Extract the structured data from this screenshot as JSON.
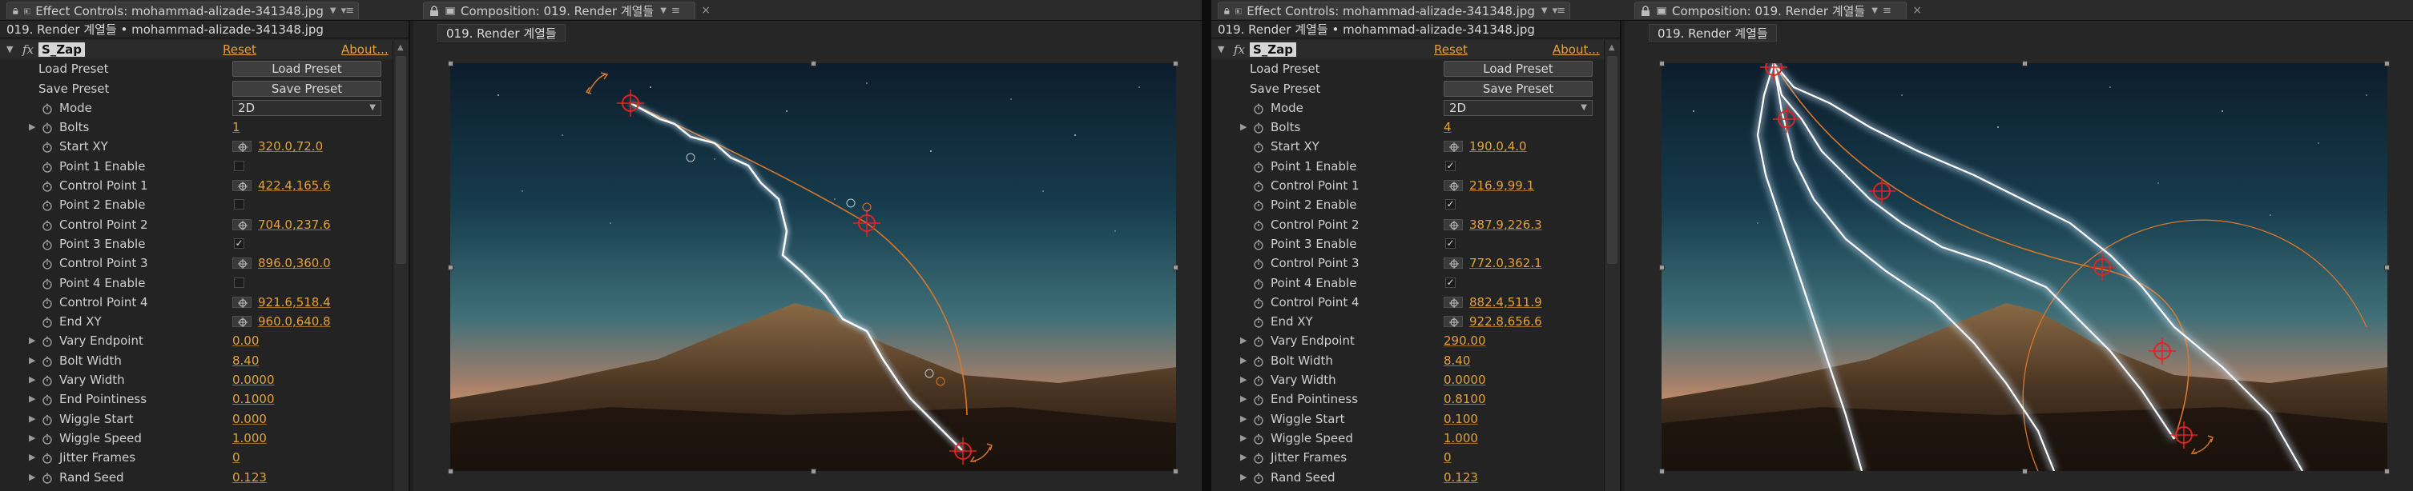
{
  "panels": [
    {
      "effect_controls": {
        "tab_title": "Effect Controls: mohammad-alizade-341348.jpg",
        "subtitle": "019. Render 계열들 • mohammad-alizade-341348.jpg",
        "effect": {
          "name": "S_Zap",
          "fx": "fx",
          "reset": "Reset",
          "about": "About..."
        },
        "rows": [
          {
            "type": "button",
            "label": "Load Preset",
            "button": "Load Preset"
          },
          {
            "type": "button",
            "label": "Save Preset",
            "button": "Save Preset"
          },
          {
            "type": "select",
            "label": "Mode",
            "value": "2D"
          },
          {
            "type": "value",
            "label": "Bolts",
            "value": "1",
            "expand": true
          },
          {
            "type": "xy",
            "label": "Start XY",
            "value": "320.0,72.0"
          },
          {
            "type": "check",
            "label": "Point 1 Enable",
            "checked": false
          },
          {
            "type": "xy",
            "label": "Control Point 1",
            "value": "422.4,165.6"
          },
          {
            "type": "check",
            "label": "Point 2 Enable",
            "checked": false
          },
          {
            "type": "xy",
            "label": "Control Point 2",
            "value": "704.0,237.6"
          },
          {
            "type": "check",
            "label": "Point 3 Enable",
            "checked": true
          },
          {
            "type": "xy",
            "label": "Control Point 3",
            "value": "896.0,360.0"
          },
          {
            "type": "check",
            "label": "Point 4 Enable",
            "checked": false
          },
          {
            "type": "xy",
            "label": "Control Point 4",
            "value": "921.6,518.4"
          },
          {
            "type": "xy",
            "label": "End XY",
            "value": "960.0,640.8"
          },
          {
            "type": "value",
            "label": "Vary Endpoint",
            "value": "0.00",
            "expand": true
          },
          {
            "type": "value",
            "label": "Bolt Width",
            "value": "8.40",
            "expand": true
          },
          {
            "type": "value",
            "label": "Vary Width",
            "value": "0.0000",
            "expand": true
          },
          {
            "type": "value",
            "label": "End Pointiness",
            "value": "0.1000",
            "expand": true
          },
          {
            "type": "value",
            "label": "Wiggle Start",
            "value": "0.000",
            "expand": true
          },
          {
            "type": "value",
            "label": "Wiggle Speed",
            "value": "1.000",
            "expand": true
          },
          {
            "type": "value",
            "label": "Jitter Frames",
            "value": "0",
            "expand": true
          },
          {
            "type": "value",
            "label": "Rand Seed",
            "value": "0.123",
            "expand": true
          }
        ]
      },
      "composition": {
        "tab_title": "Composition: 019. Render 계열들",
        "comp_tab": "019. Render 계열들"
      }
    },
    {
      "effect_controls": {
        "tab_title": "Effect Controls: mohammad-alizade-341348.jpg",
        "subtitle": "019. Render 계열들 • mohammad-alizade-341348.jpg",
        "effect": {
          "name": "S_Zap",
          "fx": "fx",
          "reset": "Reset",
          "about": "About..."
        },
        "rows": [
          {
            "type": "button",
            "label": "Load Preset",
            "button": "Load Preset"
          },
          {
            "type": "button",
            "label": "Save Preset",
            "button": "Save Preset"
          },
          {
            "type": "select",
            "label": "Mode",
            "value": "2D"
          },
          {
            "type": "value",
            "label": "Bolts",
            "value": "4",
            "expand": true
          },
          {
            "type": "xy",
            "label": "Start XY",
            "value": "190.0,4.0"
          },
          {
            "type": "check",
            "label": "Point 1 Enable",
            "checked": true
          },
          {
            "type": "xy",
            "label": "Control Point 1",
            "value": "216.9,99.1"
          },
          {
            "type": "check",
            "label": "Point 2 Enable",
            "checked": true
          },
          {
            "type": "xy",
            "label": "Control Point 2",
            "value": "387.9,226.3"
          },
          {
            "type": "check",
            "label": "Point 3 Enable",
            "checked": true
          },
          {
            "type": "xy",
            "label": "Control Point 3",
            "value": "772.0,362.1"
          },
          {
            "type": "check",
            "label": "Point 4 Enable",
            "checked": true
          },
          {
            "type": "xy",
            "label": "Control Point 4",
            "value": "882.4,511.9"
          },
          {
            "type": "xy",
            "label": "End XY",
            "value": "922.8,656.6"
          },
          {
            "type": "value",
            "label": "Vary Endpoint",
            "value": "290.00",
            "expand": true
          },
          {
            "type": "value",
            "label": "Bolt Width",
            "value": "8.40",
            "expand": true
          },
          {
            "type": "value",
            "label": "Vary Width",
            "value": "0.0000",
            "expand": true
          },
          {
            "type": "value",
            "label": "End Pointiness",
            "value": "0.8100",
            "expand": true
          },
          {
            "type": "value",
            "label": "Wiggle Start",
            "value": "0.100",
            "expand": true
          },
          {
            "type": "value",
            "label": "Wiggle Speed",
            "value": "1.000",
            "expand": true
          },
          {
            "type": "value",
            "label": "Jitter Frames",
            "value": "0",
            "expand": true
          },
          {
            "type": "value",
            "label": "Rand Seed",
            "value": "0.123",
            "expand": true
          }
        ]
      },
      "composition": {
        "tab_title": "Composition: 019. Render 계열들",
        "comp_tab": "019. Render 계열들"
      }
    }
  ],
  "colors": {
    "accent_value": "#e3a23a",
    "panel_bg": "#232323",
    "bolt": "#ffffff",
    "guide": "#d9772b",
    "crosshair": "#e02424"
  }
}
